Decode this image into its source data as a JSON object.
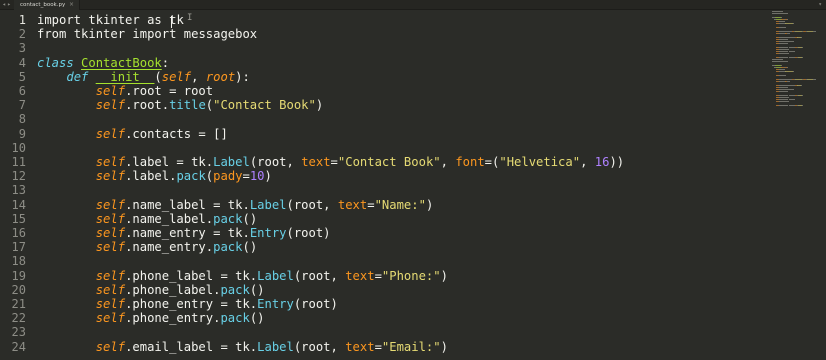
{
  "tab": {
    "filename": "contact_book.py",
    "close_glyph": "×",
    "nav_back": "◂",
    "nav_forward": "▸",
    "menu_glyph": "▾"
  },
  "editor": {
    "line_numbers": [
      "1",
      "2",
      "3",
      "4",
      "5",
      "6",
      "7",
      "8",
      "9",
      "10",
      "11",
      "12",
      "13",
      "14",
      "15",
      "16",
      "17",
      "18",
      "19",
      "20",
      "21",
      "22",
      "23",
      "24"
    ],
    "active_line": 1,
    "cursor_line": 1,
    "lines": [
      [
        {
          "t": "import",
          "c": "kw"
        },
        {
          "t": " tkinter ",
          "c": "op"
        },
        {
          "t": "as",
          "c": "kw"
        },
        {
          "t": " tk",
          "c": "op"
        }
      ],
      [
        {
          "t": "from",
          "c": "kw"
        },
        {
          "t": " tkinter ",
          "c": "op"
        },
        {
          "t": "import",
          "c": "kw"
        },
        {
          "t": " messagebox",
          "c": "op"
        }
      ],
      [],
      [
        {
          "t": "class",
          "c": "kwc"
        },
        {
          "t": " ",
          "c": "op"
        },
        {
          "t": "ContactBook",
          "c": "cls"
        },
        {
          "t": ":",
          "c": "op"
        }
      ],
      [
        {
          "t": "    ",
          "c": "op"
        },
        {
          "t": "def",
          "c": "kwc"
        },
        {
          "t": " ",
          "c": "op"
        },
        {
          "t": "__init__",
          "c": "fn"
        },
        {
          "t": "(",
          "c": "op"
        },
        {
          "t": "self",
          "c": "prm"
        },
        {
          "t": ", ",
          "c": "op"
        },
        {
          "t": "root",
          "c": "prm"
        },
        {
          "t": "):",
          "c": "op"
        }
      ],
      [
        {
          "t": "        ",
          "c": "op"
        },
        {
          "t": "self",
          "c": "slf"
        },
        {
          "t": ".root = root",
          "c": "op"
        }
      ],
      [
        {
          "t": "        ",
          "c": "op"
        },
        {
          "t": "self",
          "c": "slf"
        },
        {
          "t": ".root.",
          "c": "op"
        },
        {
          "t": "title",
          "c": "meth"
        },
        {
          "t": "(",
          "c": "op"
        },
        {
          "t": "\"Contact Book\"",
          "c": "str"
        },
        {
          "t": ")",
          "c": "op"
        }
      ],
      [],
      [
        {
          "t": "        ",
          "c": "op"
        },
        {
          "t": "self",
          "c": "slf"
        },
        {
          "t": ".contacts = []",
          "c": "op"
        }
      ],
      [],
      [
        {
          "t": "        ",
          "c": "op"
        },
        {
          "t": "self",
          "c": "slf"
        },
        {
          "t": ".label = tk.",
          "c": "op"
        },
        {
          "t": "Label",
          "c": "meth"
        },
        {
          "t": "(root, ",
          "c": "op"
        },
        {
          "t": "text",
          "c": "kwa"
        },
        {
          "t": "=",
          "c": "op"
        },
        {
          "t": "\"Contact Book\"",
          "c": "str"
        },
        {
          "t": ", ",
          "c": "op"
        },
        {
          "t": "font",
          "c": "kwa"
        },
        {
          "t": "=(",
          "c": "op"
        },
        {
          "t": "\"Helvetica\"",
          "c": "str"
        },
        {
          "t": ", ",
          "c": "op"
        },
        {
          "t": "16",
          "c": "num"
        },
        {
          "t": "))",
          "c": "op"
        }
      ],
      [
        {
          "t": "        ",
          "c": "op"
        },
        {
          "t": "self",
          "c": "slf"
        },
        {
          "t": ".label.",
          "c": "op"
        },
        {
          "t": "pack",
          "c": "meth"
        },
        {
          "t": "(",
          "c": "op"
        },
        {
          "t": "pady",
          "c": "kwa"
        },
        {
          "t": "=",
          "c": "op"
        },
        {
          "t": "10",
          "c": "num"
        },
        {
          "t": ")",
          "c": "op"
        }
      ],
      [],
      [
        {
          "t": "        ",
          "c": "op"
        },
        {
          "t": "self",
          "c": "slf"
        },
        {
          "t": ".name_label = tk.",
          "c": "op"
        },
        {
          "t": "Label",
          "c": "meth"
        },
        {
          "t": "(root, ",
          "c": "op"
        },
        {
          "t": "text",
          "c": "kwa"
        },
        {
          "t": "=",
          "c": "op"
        },
        {
          "t": "\"Name:\"",
          "c": "str"
        },
        {
          "t": ")",
          "c": "op"
        }
      ],
      [
        {
          "t": "        ",
          "c": "op"
        },
        {
          "t": "self",
          "c": "slf"
        },
        {
          "t": ".name_label.",
          "c": "op"
        },
        {
          "t": "pack",
          "c": "meth"
        },
        {
          "t": "()",
          "c": "op"
        }
      ],
      [
        {
          "t": "        ",
          "c": "op"
        },
        {
          "t": "self",
          "c": "slf"
        },
        {
          "t": ".name_entry = tk.",
          "c": "op"
        },
        {
          "t": "Entry",
          "c": "meth"
        },
        {
          "t": "(root)",
          "c": "op"
        }
      ],
      [
        {
          "t": "        ",
          "c": "op"
        },
        {
          "t": "self",
          "c": "slf"
        },
        {
          "t": ".name_entry.",
          "c": "op"
        },
        {
          "t": "pack",
          "c": "meth"
        },
        {
          "t": "()",
          "c": "op"
        }
      ],
      [],
      [
        {
          "t": "        ",
          "c": "op"
        },
        {
          "t": "self",
          "c": "slf"
        },
        {
          "t": ".phone_label = tk.",
          "c": "op"
        },
        {
          "t": "Label",
          "c": "meth"
        },
        {
          "t": "(root, ",
          "c": "op"
        },
        {
          "t": "text",
          "c": "kwa"
        },
        {
          "t": "=",
          "c": "op"
        },
        {
          "t": "\"Phone:\"",
          "c": "str"
        },
        {
          "t": ")",
          "c": "op"
        }
      ],
      [
        {
          "t": "        ",
          "c": "op"
        },
        {
          "t": "self",
          "c": "slf"
        },
        {
          "t": ".phone_label.",
          "c": "op"
        },
        {
          "t": "pack",
          "c": "meth"
        },
        {
          "t": "()",
          "c": "op"
        }
      ],
      [
        {
          "t": "        ",
          "c": "op"
        },
        {
          "t": "self",
          "c": "slf"
        },
        {
          "t": ".phone_entry = tk.",
          "c": "op"
        },
        {
          "t": "Entry",
          "c": "meth"
        },
        {
          "t": "(root)",
          "c": "op"
        }
      ],
      [
        {
          "t": "        ",
          "c": "op"
        },
        {
          "t": "self",
          "c": "slf"
        },
        {
          "t": ".phone_entry.",
          "c": "op"
        },
        {
          "t": "pack",
          "c": "meth"
        },
        {
          "t": "()",
          "c": "op"
        }
      ],
      [],
      [
        {
          "t": "        ",
          "c": "op"
        },
        {
          "t": "self",
          "c": "slf"
        },
        {
          "t": ".email_label = tk.",
          "c": "op"
        },
        {
          "t": "Label",
          "c": "meth"
        },
        {
          "t": "(root, ",
          "c": "op"
        },
        {
          "t": "text",
          "c": "kwa"
        },
        {
          "t": "=",
          "c": "op"
        },
        {
          "t": "\"Email:\"",
          "c": "str"
        },
        {
          "t": ")",
          "c": "op"
        }
      ]
    ]
  },
  "theme": {
    "background": "#2b2c28",
    "keyword_italic": "#68d0e6",
    "self": "#fd971f",
    "string": "#e6db74",
    "number": "#ae81ff",
    "function": "#a6e22e"
  },
  "cursor_glyph": "I"
}
